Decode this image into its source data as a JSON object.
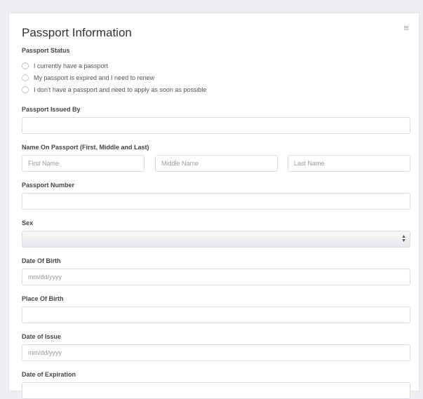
{
  "form": {
    "title": "Passport Information",
    "menu_icon": "hamburger-icon",
    "status": {
      "label": "Passport Status",
      "options": [
        "I currently have a passport",
        "My passport is expired and I need to renew",
        "I don't have a passport and need to apply as soon as possible"
      ]
    },
    "issued_by": {
      "label": "Passport Issued By",
      "value": ""
    },
    "name": {
      "label": "Name On Passport (First, Middle and Last)",
      "first_placeholder": "First Name",
      "middle_placeholder": "Middle Name",
      "last_placeholder": "Last Name"
    },
    "number": {
      "label": "Passport Number",
      "value": ""
    },
    "sex": {
      "label": "Sex",
      "selected": ""
    },
    "dob": {
      "label": "Date Of Birth",
      "placeholder": "mm/dd/yyyy"
    },
    "pob": {
      "label": "Place Of Birth",
      "value": ""
    },
    "issue": {
      "label": "Date of Issue",
      "placeholder": "mm/dd/yyyy"
    },
    "expiration": {
      "label": "Date of Expiration"
    }
  }
}
